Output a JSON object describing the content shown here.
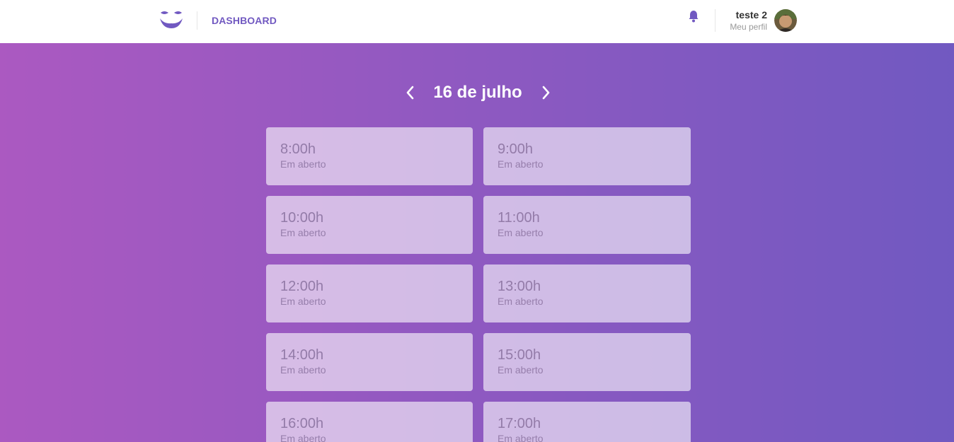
{
  "header": {
    "nav_link": "DASHBOARD",
    "user_name": "teste 2",
    "profile_link": "Meu perfil",
    "accent_color": "#7159c1",
    "icons": {
      "logo": "mustache-logo-icon",
      "notifications": "bell-icon",
      "avatar": "user-avatar"
    }
  },
  "schedule": {
    "date_label": "16 de julho",
    "prev_icon": "chevron-left-icon",
    "next_icon": "chevron-right-icon",
    "slots": [
      {
        "time": "8:00h",
        "status": "Em aberto"
      },
      {
        "time": "9:00h",
        "status": "Em aberto"
      },
      {
        "time": "10:00h",
        "status": "Em aberto"
      },
      {
        "time": "11:00h",
        "status": "Em aberto"
      },
      {
        "time": "12:00h",
        "status": "Em aberto"
      },
      {
        "time": "13:00h",
        "status": "Em aberto"
      },
      {
        "time": "14:00h",
        "status": "Em aberto"
      },
      {
        "time": "15:00h",
        "status": "Em aberto"
      },
      {
        "time": "16:00h",
        "status": "Em aberto"
      },
      {
        "time": "17:00h",
        "status": "Em aberto"
      }
    ],
    "gradient_colors": [
      "#ab59c1",
      "#7159c1"
    ]
  }
}
